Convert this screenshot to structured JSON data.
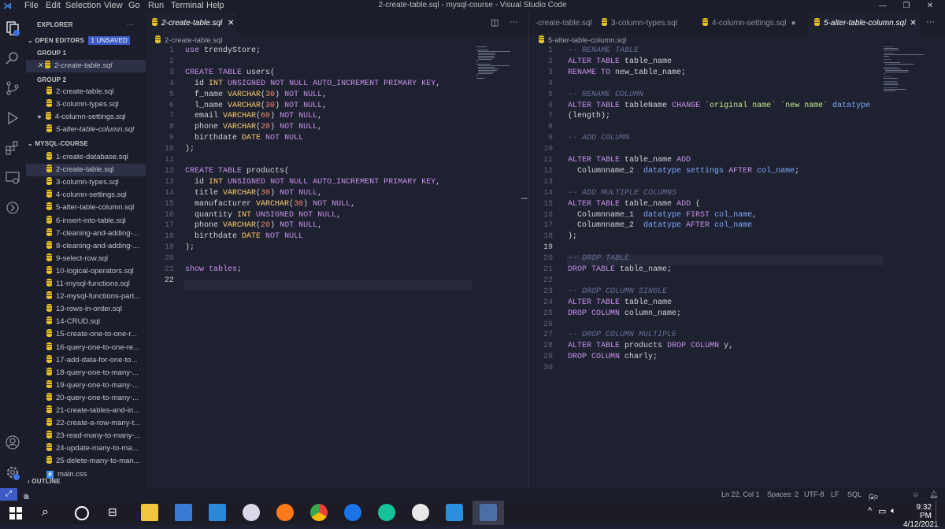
{
  "window": {
    "title": "2-create-table.sql - mysql-course - Visual Studio Code",
    "menu": [
      "File",
      "Edit",
      "Selection",
      "View",
      "Go",
      "Run",
      "Terminal",
      "Help"
    ]
  },
  "sidebar": {
    "header": "EXPLORER",
    "open_editors": "OPEN EDITORS",
    "unsaved_badge": "1 UNSAVED",
    "group1": "GROUP 1",
    "group1_items": [
      "2-create-table.sql"
    ],
    "group2": "GROUP 2",
    "group2_items": [
      "2-create-table.sql",
      "3-column-types.sql",
      "4-column-settings.sql",
      "5-alter-table-column.sql"
    ],
    "project": "MYSQL-COURSE",
    "files": [
      "1-create-database.sql",
      "2-create-table.sql",
      "3-column-types.sql",
      "4-column-settings.sql",
      "5-alter-table-column.sql",
      "6-insert-into-table.sql",
      "7-cleaning-and-adding-...",
      "8-cleaning-and-adding-...",
      "9-select-row.sql",
      "10-logical-operators.sql",
      "11-mysql-functions.sql",
      "12-mysql-functions-part...",
      "13-rows-in-order.sql",
      "14-CRUD.sql",
      "15-create-one-to-one-r...",
      "16-query-one-to-one-re...",
      "17-add-data-for-one-to...",
      "18-query-one-to-many-...",
      "19-query-one-to-many-...",
      "20-query-one-to-many-...",
      "21-create-tables-and-in...",
      "22-create-a-row-many-t...",
      "23-read-many-to-many-...",
      "24-update-many-to-ma...",
      "25-delete-many-to-man...",
      "main.css"
    ],
    "outline": "OUTLINE"
  },
  "left_editor": {
    "tab": "2-create-table.sql",
    "breadcrumb": "2-create-table.sql",
    "lines": [
      "use trendyStore;",
      "",
      "CREATE TABLE users(",
      "  id INT UNSIGNED NOT NULL AUTO_INCREMENT PRIMARY KEY,",
      "  f_name VARCHAR(30) NOT NULL,",
      "  l_name VARCHAR(30) NOT NULL,",
      "  email VARCHAR(60) NOT NULL,",
      "  phone VARCHAR(20) NOT NULL,",
      "  birthdate DATE NOT NULL",
      ");",
      "",
      "CREATE TABLE products(",
      "  id INT UNSIGNED NOT NULL AUTO_INCREMENT PRIMARY KEY,",
      "  title VARCHAR(30) NOT NULL,",
      "  manufacturer VARCHAR(30) NOT NULL,",
      "  quantity INT UNSIGNED NOT NULL,",
      "  phone VARCHAR(20) NOT NULL,",
      "  birthdate DATE NOT NULL",
      ");",
      "",
      "show tables;",
      ""
    ]
  },
  "right_editor": {
    "tabs": [
      "-create-table.sql",
      "3-column-types.sql",
      "4-column-settings.sql",
      "5-alter-table-column.sql"
    ],
    "breadcrumb": "5-alter-table-column.sql",
    "lines": [
      "-- RENAME TABLE",
      "ALTER TABLE table_name",
      "RENAME TO new_table_name;",
      "",
      "-- RENAME COLUMN",
      "ALTER TABLE tableName CHANGE `original name` `new name` datatype",
      "(length);",
      "",
      "-- ADD COLUMN",
      "",
      "ALTER TABLE table_name ADD",
      "  Columnname_2  datatype settings AFTER col_name;",
      "",
      "-- ADD MULTIPLE COLUMNS",
      "ALTER TABLE table_name ADD (",
      "  Columnname_1  datatype FIRST col_name,",
      "  Columnname_2  datatype AFTER col_name",
      ");",
      "",
      "-- DROP TABLE",
      "DROP TABLE table_name;",
      "",
      "-- DROP COLUMN SINGLE",
      "ALTER TABLE table_name",
      "DROP COLUMN column_name;",
      "",
      "-- DROP COLUMN MULTIPLE",
      "ALTER TABLE products DROP COLUMN y,",
      "DROP COLUMN charly;",
      ""
    ]
  },
  "statusbar": {
    "errors": "0",
    "warnings": "0",
    "position": "Ln 22, Col 1",
    "spaces": "Spaces: 2",
    "encoding": "UTF-8",
    "eol": "LF",
    "language": "SQL",
    "golive": "Go Live"
  },
  "taskbar": {
    "time": "9:32 PM",
    "date": "4/12/2021"
  },
  "colors": {
    "keyword": "#c792ea",
    "type": "#ffcb6b",
    "number": "#f78c6c",
    "comment": "#676e95",
    "background": "#1e2130"
  }
}
